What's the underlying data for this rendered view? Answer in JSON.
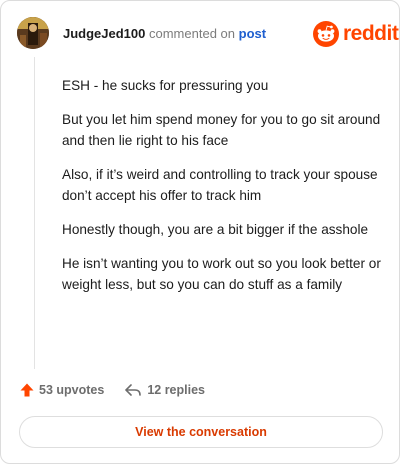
{
  "header": {
    "username": "JudgeJed100",
    "action_text": "commented on",
    "post_link": "post",
    "brand": "reddit"
  },
  "comment": {
    "paragraphs": [
      "ESH - he sucks for pressuring you",
      "But you let him spend money for you to go sit around and then lie right to his face",
      "Also, if it’s weird and controlling to track your spouse don’t accept his offer to track him",
      "Honestly though, you are a bit bigger if the asshole",
      "He isn’t wanting you to work out so you look better or weight less, but so you can do stuff as a family"
    ]
  },
  "meta": {
    "upvotes": "53 upvotes",
    "replies": "12 replies"
  },
  "cta": {
    "label": "View the conversation"
  },
  "colors": {
    "brand": "#ff4500",
    "upvote": "#ff4500",
    "link": "#1f5fcf",
    "cta_text": "#d93a00"
  },
  "icons": {
    "upvote": "upvote-arrow-icon",
    "reply": "reply-arrow-icon",
    "brand": "reddit-snoo-icon"
  }
}
